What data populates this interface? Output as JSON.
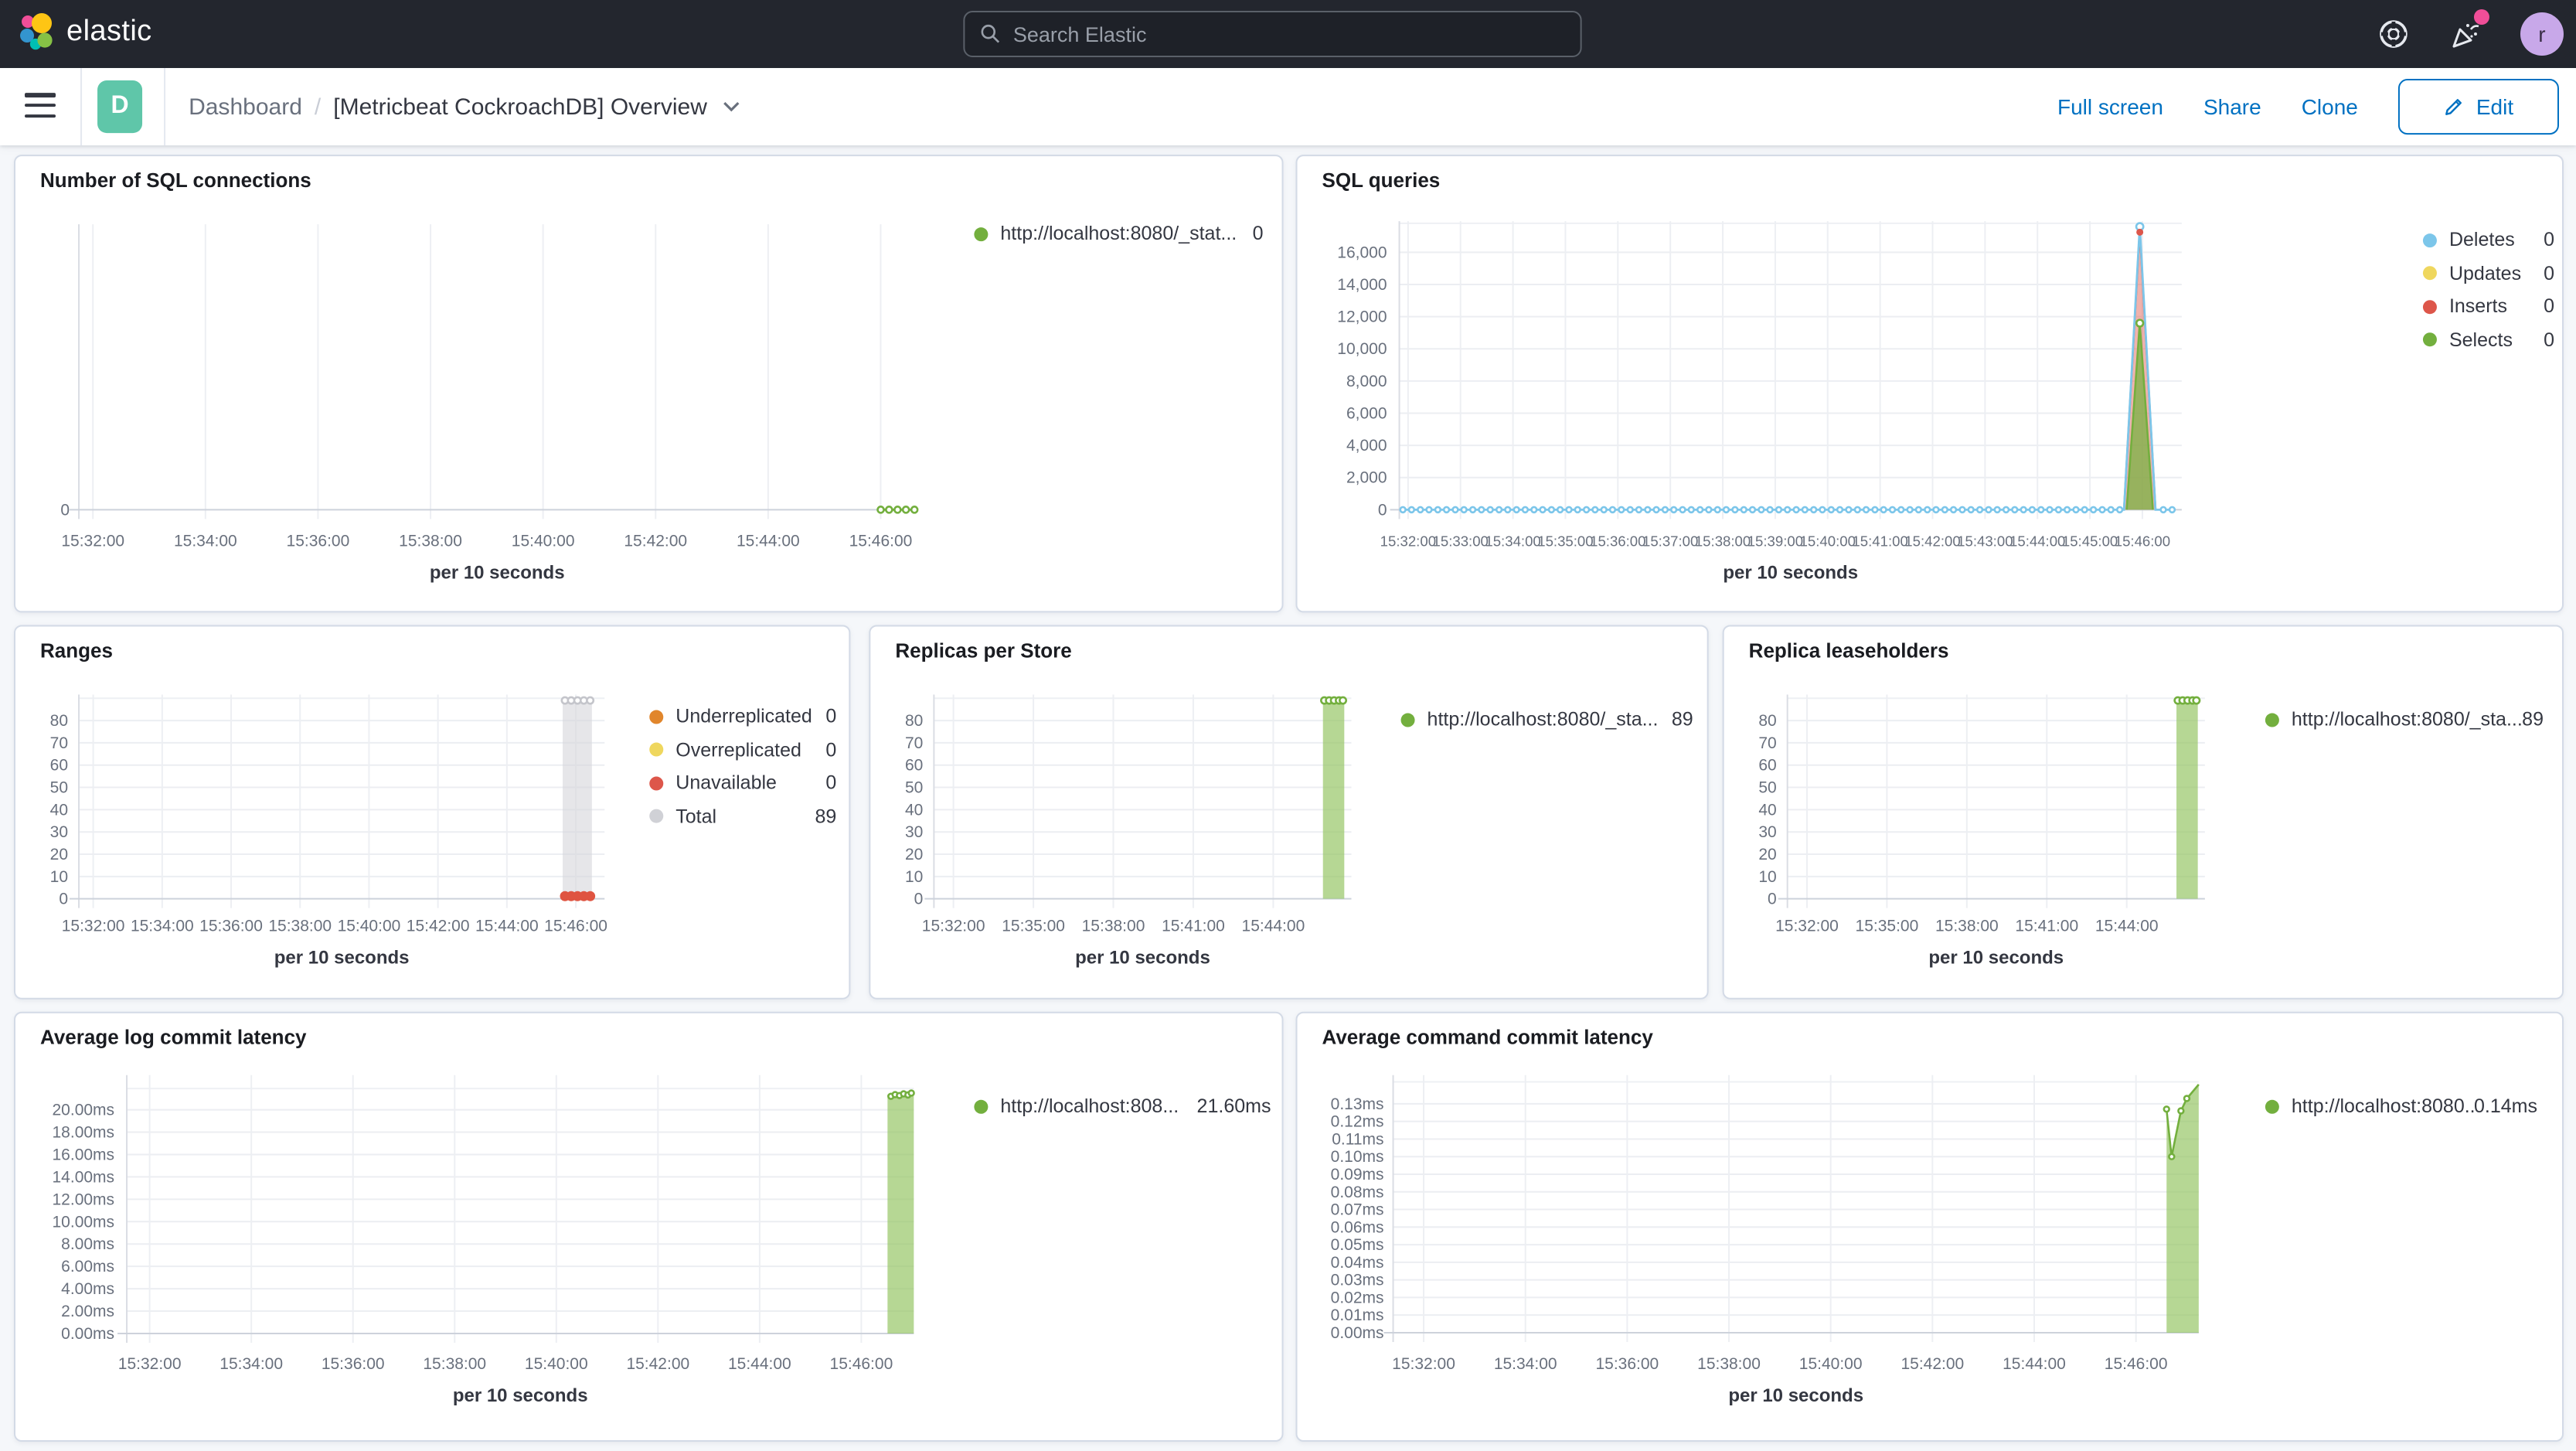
{
  "header": {
    "logo_text": "elastic",
    "search_placeholder": "Search Elastic",
    "avatar_initial": "r"
  },
  "toolbar": {
    "app_badge": "D",
    "breadcrumb_root": "Dashboard",
    "breadcrumb_separator": "/",
    "page_title": "[Metricbeat CockroachDB] Overview",
    "full_screen_label": "Full screen",
    "share_label": "Share",
    "clone_label": "Clone",
    "edit_label": "Edit"
  },
  "colors": {
    "link_blue": "#0071C2",
    "badge_teal": "#5FC6A9",
    "notification_pink": "#F04E98",
    "avatar_purple": "#C8A8E9",
    "header_bg": "#23262E",
    "page_bg": "#F5F7FA",
    "panel_border": "#D3DAE6",
    "series_green": "#73AF3E",
    "series_blue": "#7CC6EA",
    "series_yellow": "#EFD75E",
    "series_red": "#DD564A",
    "series_orange": "#E1862C",
    "series_gray": "#D0D1D6"
  },
  "panels": [
    {
      "id": "number-of-sql-connections",
      "title": "Number of SQL connections",
      "xlabel": "per 10 seconds",
      "chart_type": "line",
      "y_ticks": [
        {
          "label": "0",
          "v": 0
        }
      ],
      "x_ticks": [
        {
          "label": "15:32:00",
          "t": 120
        },
        {
          "label": "15:34:00",
          "t": 240
        },
        {
          "label": "15:36:00",
          "t": 360
        },
        {
          "label": "15:38:00",
          "t": 480
        },
        {
          "label": "15:40:00",
          "t": 600
        },
        {
          "label": "15:42:00",
          "t": 720
        },
        {
          "label": "15:44:00",
          "t": 840
        },
        {
          "label": "15:46:00",
          "t": 960
        }
      ],
      "legend": [
        {
          "label": "http://localhost:8080/_stat...",
          "value": "0",
          "color": "#73AF3E"
        }
      ],
      "series": [
        {
          "type": "line",
          "color": "#73AF3E",
          "w": 1.4,
          "points": [
            [
              960,
              0
            ],
            [
              996,
              0
            ]
          ]
        }
      ],
      "markers": [
        {
          "color": "#73AF3E",
          "r": 2,
          "pts": [
            [
              960,
              0
            ],
            [
              969,
              0
            ],
            [
              978,
              0
            ],
            [
              987,
              0
            ],
            [
              996,
              0
            ]
          ]
        }
      ]
    },
    {
      "id": "sql-queries",
      "title": "SQL queries",
      "xlabel": "per 10 seconds",
      "chart_type": "line",
      "y_ticks": [
        {
          "label": "0",
          "v": 0
        },
        {
          "label": "2,000",
          "v": 2000
        },
        {
          "label": "4,000",
          "v": 4000
        },
        {
          "label": "6,000",
          "v": 6000
        },
        {
          "label": "8,000",
          "v": 8000
        },
        {
          "label": "10,000",
          "v": 10000
        },
        {
          "label": "12,000",
          "v": 12000
        },
        {
          "label": "14,000",
          "v": 14000
        },
        {
          "label": "16,000",
          "v": 16000
        }
      ],
      "x_ticks": [
        {
          "label": "15:32:00",
          "t": 120
        },
        {
          "label": "15:33:00",
          "t": 180
        },
        {
          "label": "15:34:00",
          "t": 240
        },
        {
          "label": "15:35:00",
          "t": 300
        },
        {
          "label": "15:36:00",
          "t": 360
        },
        {
          "label": "15:37:00",
          "t": 420
        },
        {
          "label": "15:38:00",
          "t": 480
        },
        {
          "label": "15:39:00",
          "t": 540
        },
        {
          "label": "15:40:00",
          "t": 600
        },
        {
          "label": "15:41:00",
          "t": 660
        },
        {
          "label": "15:42:00",
          "t": 720
        },
        {
          "label": "15:43:00",
          "t": 780
        },
        {
          "label": "15:44:00",
          "t": 840
        },
        {
          "label": "15:45:00",
          "t": 900
        },
        {
          "label": "15:46:00",
          "t": 960
        }
      ],
      "legend": [
        {
          "label": "Deletes",
          "value": "0",
          "color": "#7CC6EA"
        },
        {
          "label": "Updates",
          "value": "0",
          "color": "#EFD75E"
        },
        {
          "label": "Inserts",
          "value": "0",
          "color": "#DD564A"
        },
        {
          "label": "Selects",
          "value": "0",
          "color": "#73AF3E"
        }
      ],
      "series": [
        {
          "type": "area",
          "color": "#DD564A",
          "fill": "rgba(221,86,74,0.45)",
          "points": [
            [
              939,
              0
            ],
            [
              957,
              17400
            ],
            [
              975,
              0
            ]
          ]
        },
        {
          "type": "area",
          "color": "#73AF3E",
          "fill": "rgba(121,177,68,0.75)",
          "points": [
            [
              942,
              0
            ],
            [
              957,
              11600
            ],
            [
              972,
              0
            ]
          ]
        },
        {
          "type": "line",
          "color": "#7CC6EA",
          "w": 1.4,
          "points": [
            [
              114,
              0
            ],
            [
              939,
              0
            ],
            [
              957,
              17600
            ],
            [
              975,
              0
            ],
            [
              996,
              0
            ]
          ]
        }
      ],
      "markers": [
        {
          "color": "#7CC6EA",
          "r": 1.7,
          "ranges": [
            {
              "from": 114,
              "to": 934,
              "step": 10,
              "v": 0
            },
            {
              "from": 984,
              "to": 994,
              "step": 10,
              "v": 0
            }
          ]
        },
        {
          "color": "#7CC6EA",
          "r": 2.3,
          "pts": [
            [
              957,
              17600
            ]
          ]
        },
        {
          "color": "#DD564A",
          "r": 1.6,
          "solid": true,
          "pts": [
            [
              957,
              17250
            ]
          ]
        },
        {
          "color": "#73AF3E",
          "r": 2.2,
          "pts": [
            [
              957,
              11600
            ]
          ]
        }
      ]
    },
    {
      "id": "ranges",
      "title": "Ranges",
      "xlabel": "per 10 seconds",
      "chart_type": "bar",
      "y_ticks": [
        {
          "label": "0",
          "v": 0
        },
        {
          "label": "10",
          "v": 10
        },
        {
          "label": "20",
          "v": 20
        },
        {
          "label": "30",
          "v": 30
        },
        {
          "label": "40",
          "v": 40
        },
        {
          "label": "50",
          "v": 50
        },
        {
          "label": "60",
          "v": 60
        },
        {
          "label": "70",
          "v": 70
        },
        {
          "label": "80",
          "v": 80
        }
      ],
      "x_ticks": [
        {
          "label": "15:32:00",
          "t": 120
        },
        {
          "label": "15:34:00",
          "t": 240
        },
        {
          "label": "15:36:00",
          "t": 360
        },
        {
          "label": "15:38:00",
          "t": 480
        },
        {
          "label": "15:40:00",
          "t": 600
        },
        {
          "label": "15:42:00",
          "t": 720
        },
        {
          "label": "15:44:00",
          "t": 840
        },
        {
          "label": "15:46:00",
          "t": 960
        }
      ],
      "legend": [
        {
          "label": "Underreplicated",
          "value": "0",
          "color": "#E1862C"
        },
        {
          "label": "Overreplicated",
          "value": "0",
          "color": "#EFD75E"
        },
        {
          "label": "Unavailable",
          "value": "0",
          "color": "#DD564A"
        },
        {
          "label": "Total",
          "value": "89",
          "color": "#D0D1D6"
        }
      ],
      "series": [
        {
          "type": "area",
          "color": "#D5D6DB",
          "fill": "rgba(213,214,219,0.6)",
          "points": [
            [
              937,
              89
            ],
            [
              988,
              89
            ]
          ]
        }
      ],
      "markers": [
        {
          "color": "#C4C5CB",
          "r": 2.1,
          "pts": [
            [
              941,
              89
            ],
            [
              952,
              89
            ],
            [
              963,
              89
            ],
            [
              974,
              89
            ],
            [
              985,
              89
            ]
          ]
        },
        {
          "color": "#DF5441",
          "r": 2.6,
          "solid": true,
          "pts": [
            [
              941,
              1.2
            ],
            [
              952,
              1.2
            ],
            [
              963,
              1.2
            ],
            [
              974,
              1.2
            ],
            [
              985,
              1.2
            ]
          ]
        }
      ]
    },
    {
      "id": "replicas-per-store",
      "title": "Replicas per Store",
      "xlabel": "per 10 seconds",
      "chart_type": "bar",
      "y_ticks": [
        {
          "label": "0",
          "v": 0
        },
        {
          "label": "10",
          "v": 10
        },
        {
          "label": "20",
          "v": 20
        },
        {
          "label": "30",
          "v": 30
        },
        {
          "label": "40",
          "v": 40
        },
        {
          "label": "50",
          "v": 50
        },
        {
          "label": "60",
          "v": 60
        },
        {
          "label": "70",
          "v": 70
        },
        {
          "label": "80",
          "v": 80
        }
      ],
      "x_ticks": [
        {
          "label": "15:32:00",
          "t": 120
        },
        {
          "label": "15:35:00",
          "t": 300
        },
        {
          "label": "15:38:00",
          "t": 480
        },
        {
          "label": "15:41:00",
          "t": 660
        },
        {
          "label": "15:44:00",
          "t": 840
        }
      ],
      "legend": [
        {
          "label": "http://localhost:8080/_sta...",
          "value": "89",
          "color": "#73AF3E"
        }
      ],
      "series": [
        {
          "type": "area",
          "color": "#8FBF5A",
          "fill": "rgba(151,198,102,0.7)",
          "points": [
            [
              952,
              89
            ],
            [
              1000,
              89
            ]
          ]
        }
      ],
      "markers": [
        {
          "color": "#73AF3E",
          "r": 2.1,
          "pts": [
            [
              955,
              89
            ],
            [
              966,
              89
            ],
            [
              977,
              89
            ],
            [
              988,
              89
            ],
            [
              997,
              89
            ]
          ]
        }
      ]
    },
    {
      "id": "replica-leaseholders",
      "title": "Replica leaseholders",
      "xlabel": "per 10 seconds",
      "chart_type": "bar",
      "y_ticks": [
        {
          "label": "0",
          "v": 0
        },
        {
          "label": "10",
          "v": 10
        },
        {
          "label": "20",
          "v": 20
        },
        {
          "label": "30",
          "v": 30
        },
        {
          "label": "40",
          "v": 40
        },
        {
          "label": "50",
          "v": 50
        },
        {
          "label": "60",
          "v": 60
        },
        {
          "label": "70",
          "v": 70
        },
        {
          "label": "80",
          "v": 80
        }
      ],
      "x_ticks": [
        {
          "label": "15:32:00",
          "t": 120
        },
        {
          "label": "15:35:00",
          "t": 300
        },
        {
          "label": "15:38:00",
          "t": 480
        },
        {
          "label": "15:41:00",
          "t": 660
        },
        {
          "label": "15:44:00",
          "t": 840
        }
      ],
      "legend": [
        {
          "label": "http://localhost:8080/_sta...",
          "value": "89",
          "color": "#73AF3E"
        }
      ],
      "series": [
        {
          "type": "area",
          "color": "#8FBF5A",
          "fill": "rgba(151,198,102,0.7)",
          "points": [
            [
              952,
              89
            ],
            [
              1000,
              89
            ]
          ]
        }
      ],
      "markers": [
        {
          "color": "#73AF3E",
          "r": 2.1,
          "pts": [
            [
              955,
              89
            ],
            [
              966,
              89
            ],
            [
              977,
              89
            ],
            [
              988,
              89
            ],
            [
              997,
              89
            ]
          ]
        }
      ]
    },
    {
      "id": "average-log-commit-latency",
      "title": "Average log commit latency",
      "xlabel": "per 10 seconds",
      "chart_type": "area",
      "y_ticks": [
        {
          "label": "0.00ms",
          "v": 0
        },
        {
          "label": "2.00ms",
          "v": 2
        },
        {
          "label": "4.00ms",
          "v": 4
        },
        {
          "label": "6.00ms",
          "v": 6
        },
        {
          "label": "8.00ms",
          "v": 8
        },
        {
          "label": "10.00ms",
          "v": 10
        },
        {
          "label": "12.00ms",
          "v": 12
        },
        {
          "label": "14.00ms",
          "v": 14
        },
        {
          "label": "16.00ms",
          "v": 16
        },
        {
          "label": "18.00ms",
          "v": 18
        },
        {
          "label": "20.00ms",
          "v": 20
        }
      ],
      "x_ticks": [
        {
          "label": "15:32:00",
          "t": 120
        },
        {
          "label": "15:34:00",
          "t": 240
        },
        {
          "label": "15:36:00",
          "t": 360
        },
        {
          "label": "15:38:00",
          "t": 480
        },
        {
          "label": "15:40:00",
          "t": 600
        },
        {
          "label": "15:42:00",
          "t": 720
        },
        {
          "label": "15:44:00",
          "t": 840
        },
        {
          "label": "15:46:00",
          "t": 960
        }
      ],
      "legend": [
        {
          "label": "http://localhost:808...",
          "value": "21.60ms",
          "color": "#73AF3E"
        }
      ],
      "series": [
        {
          "type": "area",
          "color": "#73AF3E",
          "fill": "rgba(151,198,102,0.7)",
          "points": [
            [
              991,
              21.3
            ],
            [
              995,
              21.2
            ],
            [
              1000,
              21.35
            ],
            [
              1005,
              21.27
            ],
            [
              1010,
              21.42
            ],
            [
              1015,
              21.33
            ],
            [
              1022,
              21.6
            ]
          ]
        }
      ],
      "markers": [
        {
          "color": "#73AF3E",
          "r": 1.7,
          "pts": [
            [
              995,
              21.2
            ],
            [
              1000,
              21.35
            ],
            [
              1005,
              21.27
            ],
            [
              1010,
              21.42
            ],
            [
              1015,
              21.33
            ],
            [
              1019,
              21.5
            ]
          ]
        }
      ]
    },
    {
      "id": "average-command-commit-latency",
      "title": "Average command commit latency",
      "xlabel": "per 10 seconds",
      "chart_type": "area",
      "y_ticks": [
        {
          "label": "0.00ms",
          "v": 0
        },
        {
          "label": "0.01ms",
          "v": 0.01
        },
        {
          "label": "0.02ms",
          "v": 0.02
        },
        {
          "label": "0.03ms",
          "v": 0.03
        },
        {
          "label": "0.04ms",
          "v": 0.04
        },
        {
          "label": "0.05ms",
          "v": 0.05
        },
        {
          "label": "0.06ms",
          "v": 0.06
        },
        {
          "label": "0.07ms",
          "v": 0.07
        },
        {
          "label": "0.08ms",
          "v": 0.08
        },
        {
          "label": "0.09ms",
          "v": 0.09
        },
        {
          "label": "0.10ms",
          "v": 0.1
        },
        {
          "label": "0.11ms",
          "v": 0.11
        },
        {
          "label": "0.12ms",
          "v": 0.12
        },
        {
          "label": "0.13ms",
          "v": 0.13
        }
      ],
      "x_ticks": [
        {
          "label": "15:32:00",
          "t": 120
        },
        {
          "label": "15:34:00",
          "t": 240
        },
        {
          "label": "15:36:00",
          "t": 360
        },
        {
          "label": "15:38:00",
          "t": 480
        },
        {
          "label": "15:40:00",
          "t": 600
        },
        {
          "label": "15:42:00",
          "t": 720
        },
        {
          "label": "15:44:00",
          "t": 840
        },
        {
          "label": "15:46:00",
          "t": 960
        }
      ],
      "legend": [
        {
          "label": "http://localhost:8080...",
          "value": "0.14ms",
          "color": "#73AF3E"
        }
      ],
      "series": [
        {
          "type": "area",
          "color": "#73AF3E",
          "fill": "rgba(151,198,102,0.7)",
          "points": [
            [
              996,
              0.127
            ],
            [
              1002,
              0.1
            ],
            [
              1013,
              0.126
            ],
            [
              1020,
              0.133
            ],
            [
              1034,
              0.141
            ]
          ]
        }
      ],
      "markers": [
        {
          "color": "#73AF3E",
          "r": 1.7,
          "pts": [
            [
              996,
              0.127
            ],
            [
              1002,
              0.1
            ],
            [
              1013,
              0.126
            ],
            [
              1020,
              0.133
            ]
          ]
        }
      ]
    }
  ]
}
